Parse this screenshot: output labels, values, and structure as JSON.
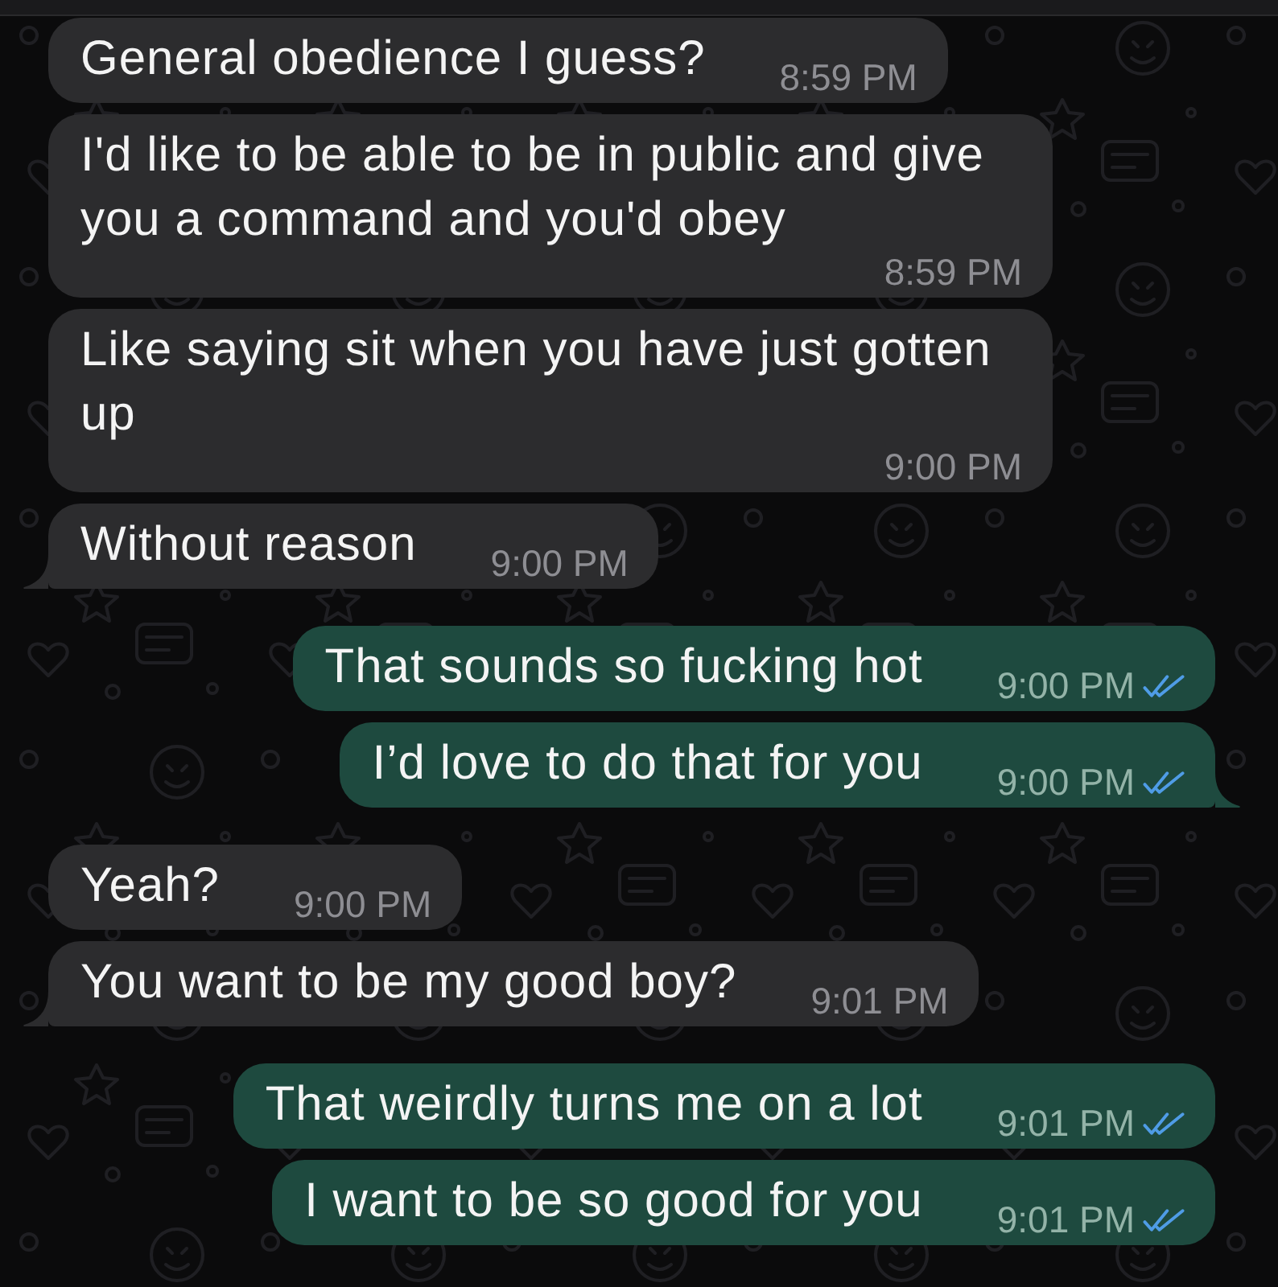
{
  "messages": [
    {
      "kind": "incoming",
      "text": "General obedience I guess?",
      "time": "8:59 PM"
    },
    {
      "kind": "incoming",
      "text": "I'd like to be able to be in public and give you a command and you'd obey",
      "time": "8:59 PM"
    },
    {
      "kind": "incoming",
      "text": "Like saying sit when you have just gotten up",
      "time": "9:00 PM"
    },
    {
      "kind": "incoming",
      "text": "Without reason",
      "time": "9:00 PM"
    },
    {
      "kind": "outgoing",
      "text": "That sounds so fucking hot",
      "time": "9:00 PM",
      "read": true
    },
    {
      "kind": "outgoing",
      "text": "I’d love to do that for you",
      "time": "9:00 PM",
      "read": true
    },
    {
      "kind": "incoming",
      "text": "Yeah?",
      "time": "9:00 PM"
    },
    {
      "kind": "incoming",
      "text": "You want to be my good boy?",
      "time": "9:01 PM"
    },
    {
      "kind": "outgoing",
      "text": "That weirdly turns me on a lot",
      "time": "9:01 PM",
      "read": true
    },
    {
      "kind": "outgoing",
      "text": "I want to be so good for you",
      "time": "9:01 PM",
      "read": true
    }
  ]
}
